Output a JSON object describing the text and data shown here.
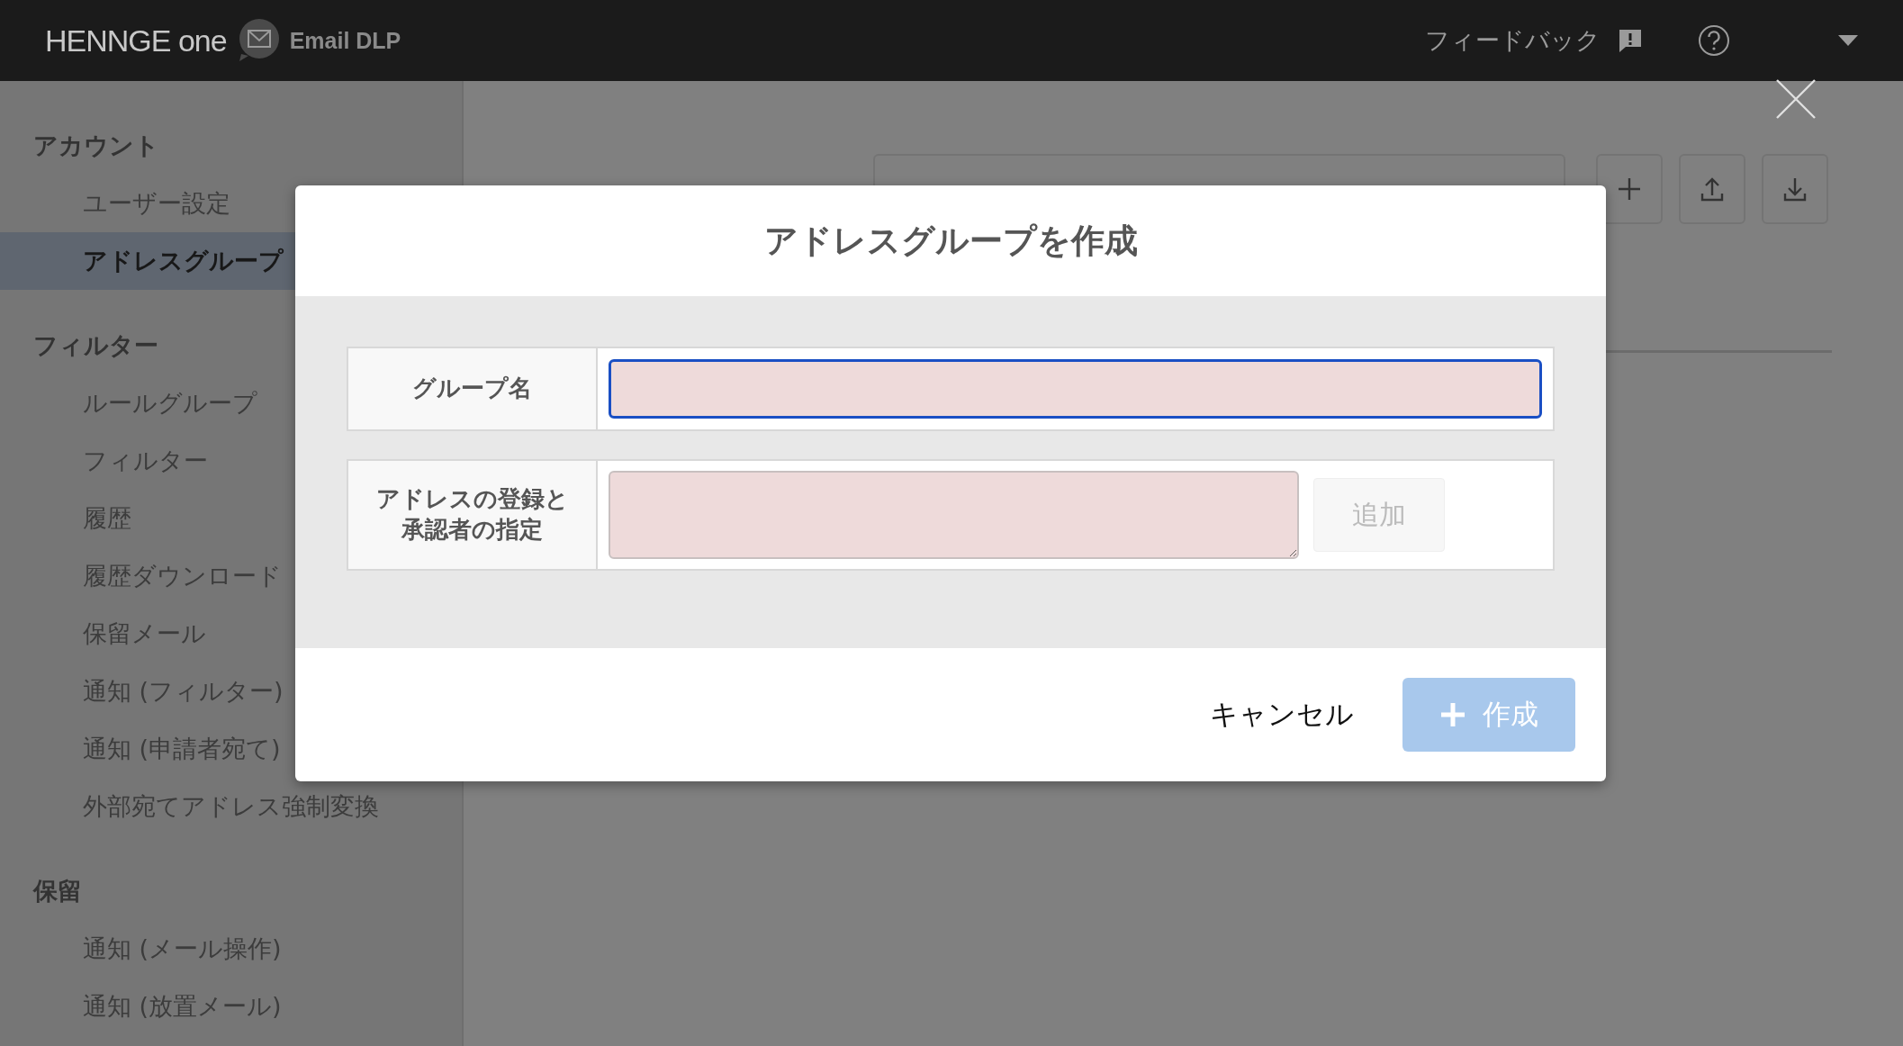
{
  "header": {
    "logo": "HENNGE one",
    "product": "Email DLP",
    "feedback": "フィードバック"
  },
  "sidebar": {
    "sections": [
      {
        "title": "アカウント",
        "items": [
          {
            "label": "ユーザー設定",
            "selected": false
          },
          {
            "label": "アドレスグループ",
            "selected": true
          }
        ]
      },
      {
        "title": "フィルター",
        "items": [
          {
            "label": "ルールグループ",
            "selected": false
          },
          {
            "label": "フィルター",
            "selected": false
          },
          {
            "label": "履歴",
            "selected": false
          },
          {
            "label": "履歴ダウンロード",
            "selected": false
          },
          {
            "label": "保留メール",
            "selected": false
          },
          {
            "label": "通知 (フィルター)",
            "selected": false
          },
          {
            "label": "通知 (申請者宛て)",
            "selected": false
          },
          {
            "label": "外部宛てアドレス強制変換",
            "selected": false
          }
        ]
      },
      {
        "title": "保留",
        "items": [
          {
            "label": "通知 (メール操作)",
            "selected": false
          },
          {
            "label": "通知 (放置メール)",
            "selected": false
          }
        ]
      }
    ]
  },
  "modal": {
    "title": "アドレスグループを作成",
    "fields": [
      {
        "kind": "text",
        "label": "グループ名",
        "focused": true
      },
      {
        "kind": "textarea",
        "label": "アドレスの登録と承認者の指定",
        "focused": false,
        "button": {
          "label": "追加",
          "disabled": true
        }
      }
    ],
    "cancel": "キャンセル",
    "submit": {
      "label": "作成",
      "disabled": true
    }
  }
}
